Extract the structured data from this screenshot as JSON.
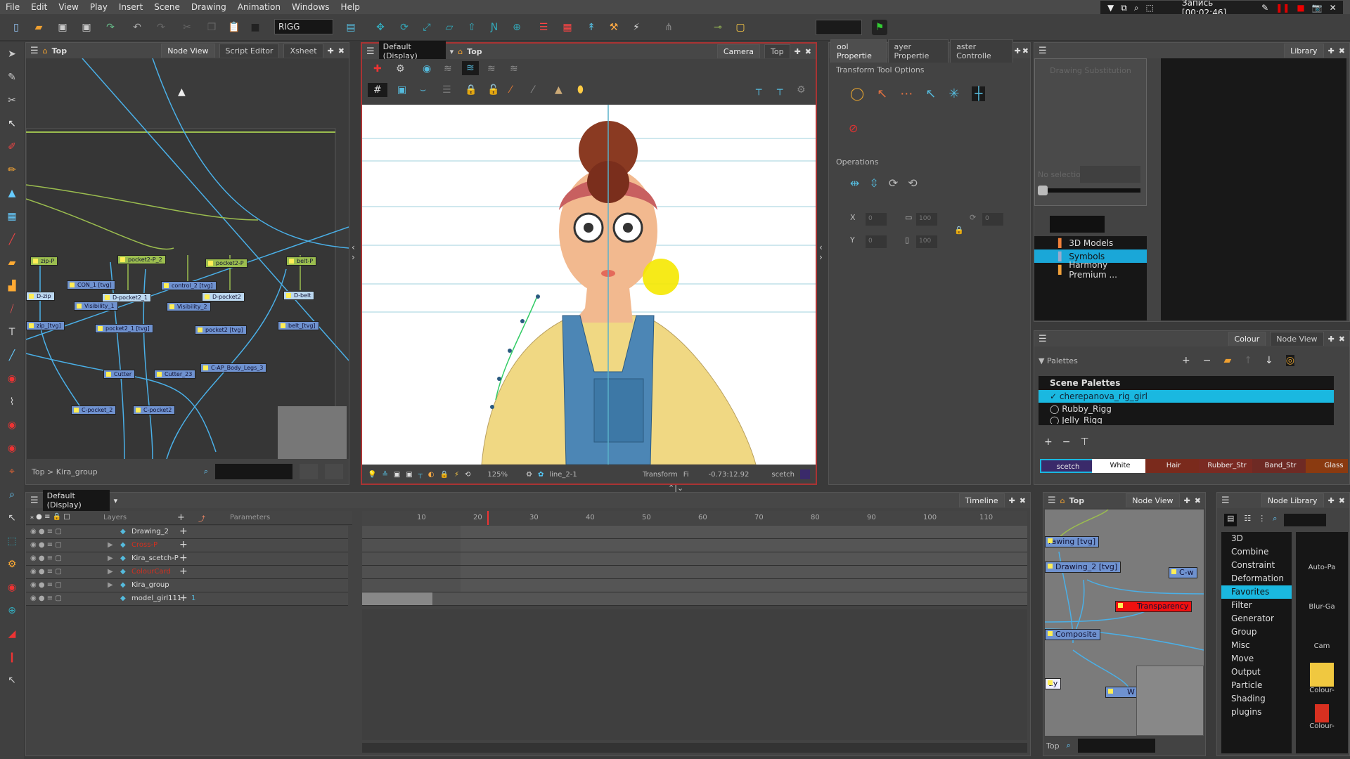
{
  "menu": [
    "File",
    "Edit",
    "View",
    "Play",
    "Insert",
    "Scene",
    "Drawing",
    "Animation",
    "Windows",
    "Help"
  ],
  "recorder": {
    "label": "Запись [00:02:46]"
  },
  "toolbar": {
    "workspace": "RIGG"
  },
  "node_view": {
    "path_label": "Top",
    "tabs": [
      "Node View",
      "Script Editor",
      "Xsheet"
    ],
    "breadcrumb": "Top  >  Kira_group",
    "nodes": [
      "zip-P",
      "pocket2-P_2",
      "pocket2-P",
      "belt-P",
      "CON_1 [tvg]",
      "control_2 [tvg]",
      "D-zip",
      "D-pocket2_1",
      "D-pocket2",
      "D-belt",
      "Visibility_1",
      "Visibility_2",
      "zip_[tvg]",
      "pocket2_1 [tvg]",
      "pocket2 [tvg]",
      "belt_[tvg]",
      "Cutter",
      "Cutter_23",
      "C-AP_Body_Legs_3",
      "C-pocket_2",
      "C-pocket2"
    ]
  },
  "camera_view": {
    "display": "Default (Display)",
    "path_label": "Top",
    "tabs": [
      "Camera",
      "Top"
    ],
    "status": {
      "zoom": "125%",
      "drawing": "line_2-1",
      "tool": "Transform",
      "frame_label": "Fi",
      "coords": "-0.73:12.92",
      "colour": "scetch"
    }
  },
  "tool_properties": {
    "tabs": [
      "ool Propertie",
      "ayer Propertie",
      "aster Controlle"
    ],
    "section_options": "Transform Tool Options",
    "section_operations": "Operations",
    "fields": {
      "x": "0",
      "y": "0",
      "width": "100",
      "height": "100",
      "angle": "0",
      "x_label": "X",
      "y_label": "Y"
    }
  },
  "library": {
    "tab": "Library",
    "substitution_title": "Drawing Substitution",
    "no_selection": "No selection",
    "items": [
      "3D Models",
      "Symbols",
      "Harmony Premium ..."
    ],
    "selected": "Symbols"
  },
  "colour": {
    "tabs": [
      "Colour",
      "Node View"
    ],
    "palettes_label": "Palettes",
    "scene_palettes": "Scene Palettes",
    "palettes": [
      "cherepanova_rig_girl",
      "Rubby_Rigg",
      "Jelly_Rigg"
    ],
    "selected_palette": "cherepanova_rig_girl",
    "swatches": [
      {
        "name": "scetch",
        "color": "#3a2a6a"
      },
      {
        "name": "White",
        "color": "#ffffff"
      },
      {
        "name": "Hair",
        "color": "#7a2a1c"
      },
      {
        "name": "Rubber_Str",
        "color": "#7a2a22"
      },
      {
        "name": "Band_Str",
        "color": "#6e2a24"
      },
      {
        "name": "Glass",
        "color": "#8a3a10"
      }
    ]
  },
  "timeline": {
    "display": "Default (Display)",
    "tab": "Timeline",
    "layers_header": "Layers",
    "params_header": "Parameters",
    "layers": [
      {
        "name": "Drawing_2",
        "color": "#dddddd",
        "param": ""
      },
      {
        "name": "Cross-P",
        "color": "#d03020",
        "param": ""
      },
      {
        "name": "Kira_scetch-P",
        "color": "#dddddd",
        "param": ""
      },
      {
        "name": "ColourCard",
        "color": "#d03020",
        "param": ""
      },
      {
        "name": "Kira_group",
        "color": "#dddddd",
        "param": ""
      },
      {
        "name": "model_girl111",
        "color": "#dddddd",
        "param": "1"
      }
    ],
    "frame_labels": [
      "10",
      "20",
      "30",
      "40",
      "50",
      "60",
      "70",
      "80",
      "90",
      "100",
      "110"
    ],
    "current_frame": 18
  },
  "node_view_small": {
    "path_label": "Top",
    "tab": "Node View",
    "breadcrumb": "Top",
    "nodes": [
      "rawing [tvg]",
      "Drawing_2 [tvg]",
      "Transparency",
      "Composite",
      "C-w",
      "ay",
      "W"
    ]
  },
  "node_library": {
    "tab": "Node Library",
    "categories": [
      "3D",
      "Combine",
      "Constraint",
      "Deformation",
      "Favorites",
      "Filter",
      "Generator",
      "Group",
      "Misc",
      "Move",
      "Output",
      "Particle",
      "Shading",
      "plugins"
    ],
    "selected": "Favorites",
    "previews": [
      "Auto-Pa",
      "Blur-Ga",
      "Cam",
      "Colour-",
      "Colour-"
    ]
  }
}
